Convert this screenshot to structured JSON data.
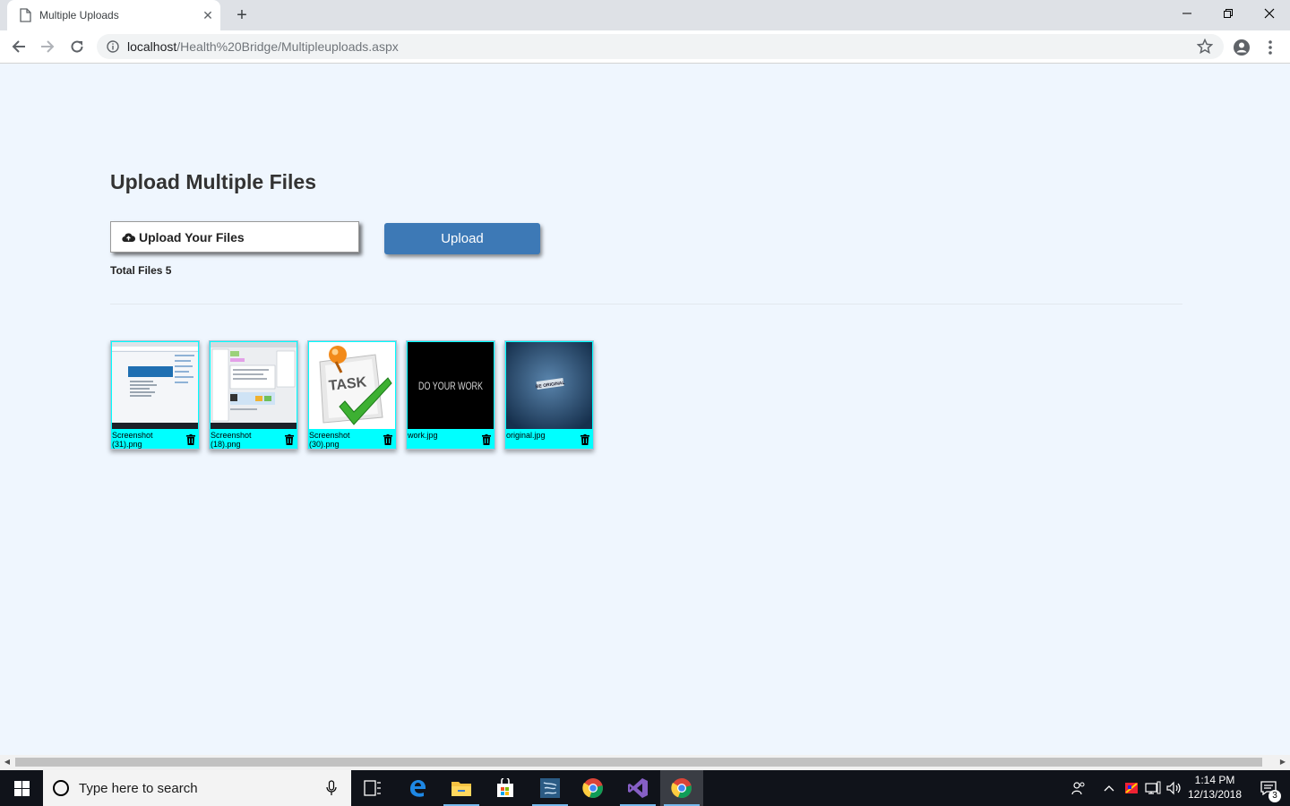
{
  "browser": {
    "tab_title": "Multiple Uploads",
    "url_host": "localhost",
    "url_path": "/Health%20Bridge/Multipleuploads.aspx"
  },
  "page": {
    "title": "Upload Multiple Files",
    "choose_label": "Upload Your Files",
    "upload_label": "Upload",
    "total_files_text": "Total Files 5"
  },
  "files": [
    {
      "name": "Screenshot (31).png",
      "preview": "screenshot-browser"
    },
    {
      "name": "Screenshot (18).png",
      "preview": "screenshot-app"
    },
    {
      "name": "Screenshot (30).png",
      "preview": "task-clipart"
    },
    {
      "name": "work.jpg",
      "preview": "do-your-work"
    },
    {
      "name": "original.jpg",
      "preview": "be-original"
    }
  ],
  "previews": {
    "task_word": "TASK",
    "work_text": "DO YOUR WORK",
    "original_text": "BE ORIGINAL"
  },
  "taskbar": {
    "search_placeholder": "Type here to search",
    "time": "1:14 PM",
    "date": "12/13/2018",
    "notification_count": "3"
  },
  "colors": {
    "page_bg": "#eff6fe",
    "upload_button": "#3d79b6",
    "file_card": "#00ffff"
  }
}
